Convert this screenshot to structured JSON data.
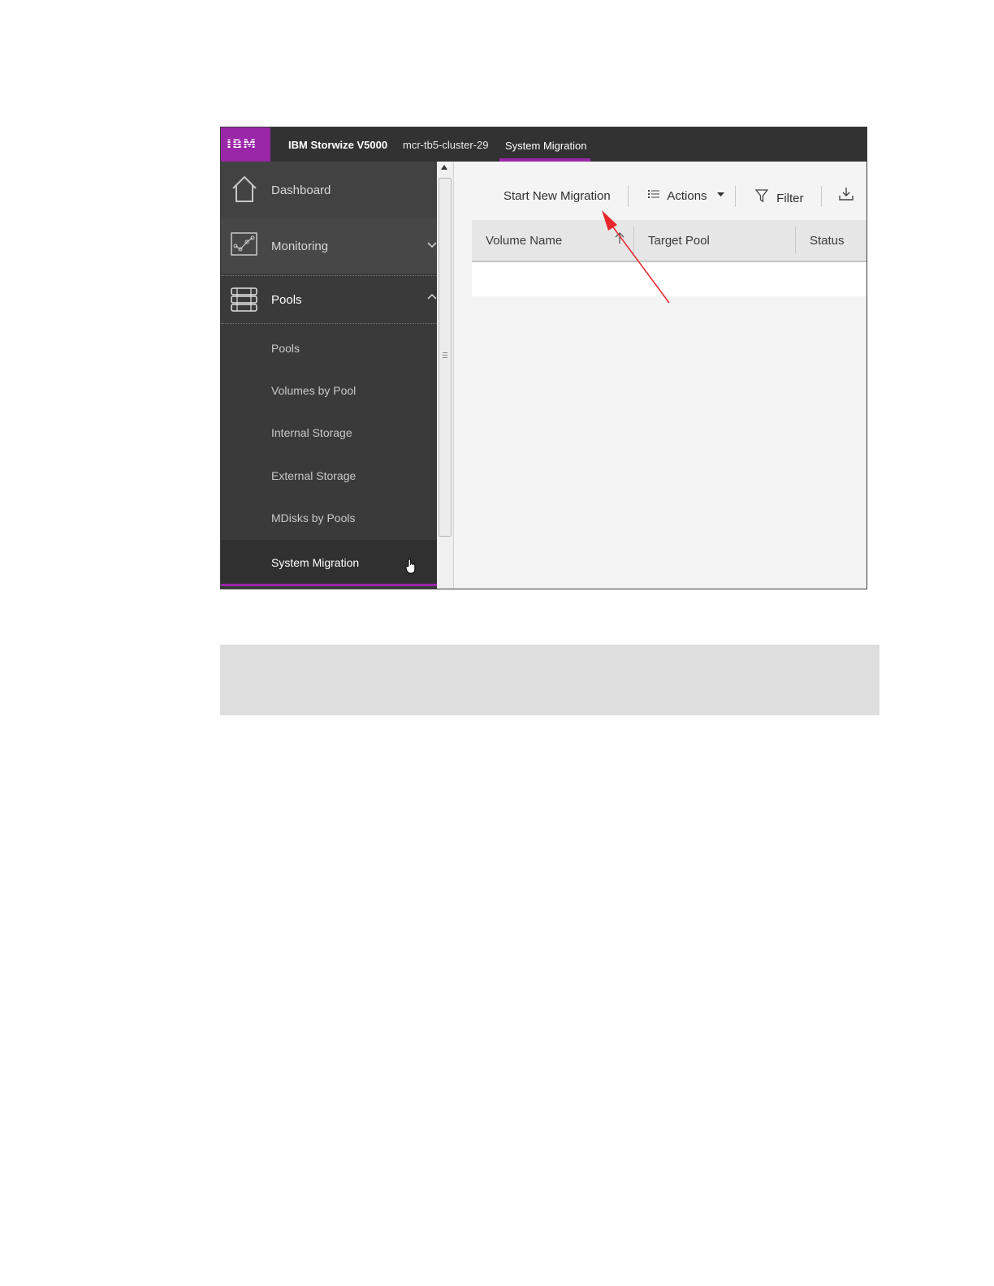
{
  "header": {
    "logo": "IBM",
    "product": "IBM Storwize V5000",
    "cluster": "mcr-tb5-cluster-29",
    "breadcrumb": "System Migration"
  },
  "sidebar": {
    "main_items": [
      {
        "label": "Dashboard",
        "icon": "home-icon"
      },
      {
        "label": "Monitoring",
        "icon": "monitoring-icon"
      },
      {
        "label": "Pools",
        "icon": "pools-icon"
      }
    ],
    "sub_items": [
      {
        "label": "Pools"
      },
      {
        "label": "Volumes by Pool"
      },
      {
        "label": "Internal Storage"
      },
      {
        "label": "External Storage"
      },
      {
        "label": "MDisks by Pools"
      },
      {
        "label": "System Migration"
      }
    ],
    "active_item": "System Migration"
  },
  "toolbar": {
    "start_label": "Start New Migration",
    "actions_label": "Actions",
    "filter_label": "Filter",
    "export_icon": "download-icon"
  },
  "table": {
    "columns": [
      "Volume Name",
      "Target Pool",
      "Status"
    ],
    "sort_column": "Volume Name",
    "sort_direction": "ascending",
    "rows": []
  },
  "colors": {
    "accent": "#9a26a8",
    "topbar": "#323232",
    "sidebar": "#3a3a3a",
    "annotation_arrow": "#e8262b"
  }
}
